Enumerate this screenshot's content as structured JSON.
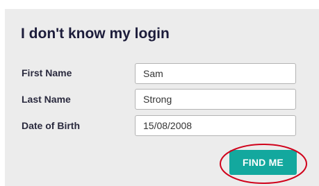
{
  "form": {
    "title": "I don't know my login",
    "fields": [
      {
        "label": "First Name",
        "value": "Sam"
      },
      {
        "label": "Last Name",
        "value": "Strong"
      },
      {
        "label": "Date of Birth",
        "value": "15/08/2008"
      }
    ],
    "submit_label": "FIND ME"
  },
  "colors": {
    "panel_background": "#ececec",
    "button_background": "#13a89e",
    "highlight_ring": "#d0021b",
    "title_text": "#1c1c3a"
  }
}
